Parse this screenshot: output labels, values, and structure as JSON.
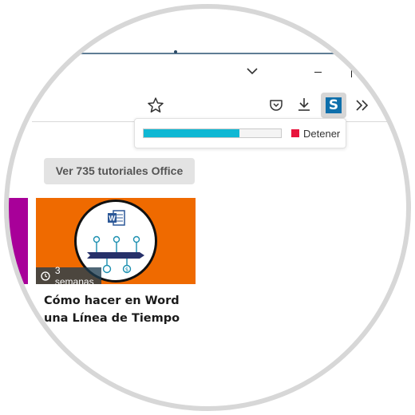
{
  "browser": {
    "toolbar": {
      "bookmark_icon": "star-icon",
      "pocket_icon": "pocket-icon",
      "downloads_icon": "download-icon",
      "extension_icon": "s-extension-icon",
      "extension_letter": "S",
      "overflow_icon": "double-chevron-icon"
    },
    "window_controls": [
      "chevron-down-icon",
      "minimize-icon",
      "maximize-icon"
    ]
  },
  "download_popup": {
    "progress": 0.7,
    "progress_color": "#0fb8d4",
    "stop_label": "Detener",
    "stop_color": "#e8143c"
  },
  "page": {
    "more_button_label": "Ver 735 tutoriales Office",
    "card": {
      "badge_text": "3 semanas",
      "title": "Cómo hacer en Word una Línea de Tiempo",
      "thumbnail_bg": "#ef6a00"
    },
    "side_tile_color": "#a80099"
  }
}
